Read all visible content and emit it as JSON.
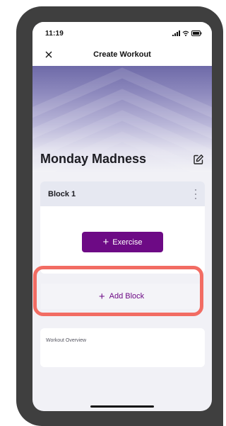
{
  "status_bar": {
    "time": "11:19",
    "icons": [
      "signal-icon",
      "wifi-icon",
      "battery-icon"
    ]
  },
  "nav": {
    "title": "Create Workout",
    "close_icon": "close-icon"
  },
  "workout": {
    "name": "Monday Madness",
    "edit_icon": "edit-icon"
  },
  "block": {
    "title": "Block 1",
    "menu_icon": "more-vertical-icon",
    "exercise_label": "Exercise"
  },
  "add_block": {
    "label": "Add Block"
  },
  "overview": {
    "label": "Workout Overview"
  },
  "colors": {
    "accent": "#6d0a85",
    "highlight": "#f26c63",
    "hero_top": "#6e6aa8",
    "background": "#f1f1f6"
  }
}
